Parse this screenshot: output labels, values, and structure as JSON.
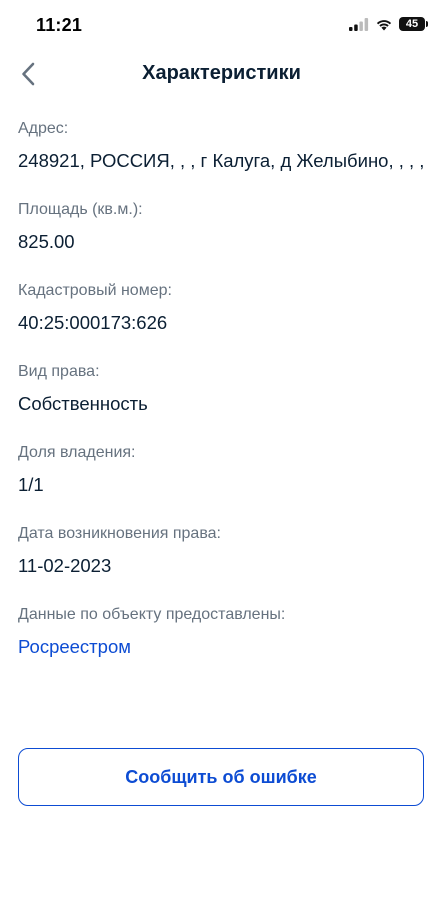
{
  "status_bar": {
    "time": "11:21",
    "battery": "45",
    "icons": [
      "signal-icon",
      "wifi-icon",
      "battery-icon"
    ]
  },
  "header": {
    "title": "Характеристики",
    "back_icon": "chevron-left-icon"
  },
  "fields": [
    {
      "label": "Адрес:",
      "value": "248921, РОССИЯ, , , г Калуга, д Желыбино, , , ,"
    },
    {
      "label": "Площадь (кв.м.):",
      "value": "825.00"
    },
    {
      "label": "Кадастровый номер:",
      "value": "40:25:000173:626"
    },
    {
      "label": "Вид права:",
      "value": "Собственность"
    },
    {
      "label": "Доля владения:",
      "value": "1/1"
    },
    {
      "label": "Дата возникновения права:",
      "value": "11-02-2023"
    }
  ],
  "source": {
    "label": "Данные по объекту предоставлены:",
    "link_text": "Росреестром"
  },
  "report_button": {
    "label": "Сообщить об ошибке"
  },
  "colors": {
    "text_primary": "#0b1f33",
    "text_secondary": "#66727f",
    "accent": "#0d4cd3"
  }
}
